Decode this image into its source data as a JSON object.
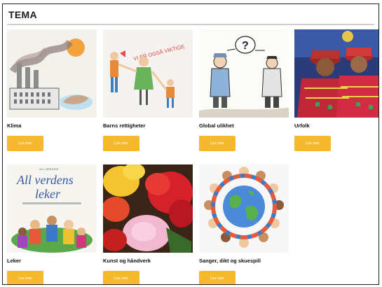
{
  "page": {
    "title": "TEMA"
  },
  "cards": [
    {
      "label": "Klima",
      "button": "Les mer"
    },
    {
      "label": "Barns rettigheter",
      "button": "Les mer",
      "sign_text": "VI ER OGSÅ VIKTIGE"
    },
    {
      "label": "Global ulikhet",
      "button": "Les mer",
      "bubble_text": "?"
    },
    {
      "label": "Urfolk",
      "button": "Les mer"
    },
    {
      "label": "Leker",
      "button": "Les mer",
      "cover_top": "ALL VERDENS",
      "cover_title_1": "All verdens",
      "cover_title_2": "leker"
    },
    {
      "label": "Kunst og håndverk",
      "button": "Les mer"
    },
    {
      "label": "Sanger, dikt og skuespill",
      "button": "Les mer"
    }
  ],
  "colors": {
    "button": "#f6b82f",
    "divider": "#cfcfcf"
  }
}
